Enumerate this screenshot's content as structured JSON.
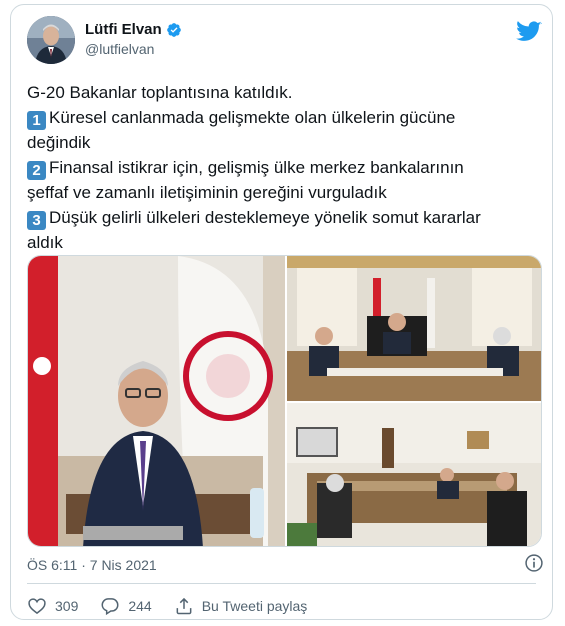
{
  "tweet": {
    "author": {
      "display_name": "Lütfi Elvan",
      "handle": "@lutfielvan"
    },
    "lines": [
      {
        "badge": "",
        "text": "G-20 Bakanlar toplantısına katıldık."
      },
      {
        "badge": "1",
        "text": "Küresel canlanmada gelişmekte olan ülkelerin gücüne"
      },
      {
        "badge": "",
        "text": "değindik"
      },
      {
        "badge": "2",
        "text": "Finansal istikrar için, gelişmiş ülke merkez bankalarının"
      },
      {
        "badge": "",
        "text": "şeffaf ve zamanlı iletişiminin gereğini vurguladık"
      },
      {
        "badge": "3",
        "text": "Düşük gelirli ülkeleri desteklemeye yönelik somut kararlar"
      },
      {
        "badge": "",
        "text": "aldık"
      }
    ],
    "timestamp": "ÖS 6:11 · 7 Nis 2021",
    "actions": {
      "likes": "309",
      "replies": "244",
      "share_label": "Bu Tweeti paylaş"
    }
  },
  "colors": {
    "text": "#0f1419",
    "secondary": "#536471",
    "twitter_blue": "#1d9bf0",
    "border": "#cfd9de",
    "emoji_blue": "#3b88c3"
  },
  "icons": [
    "twitter-logo-icon",
    "verified-badge-icon",
    "info-icon",
    "heart-icon",
    "reply-bubble-icon",
    "share-icon"
  ]
}
